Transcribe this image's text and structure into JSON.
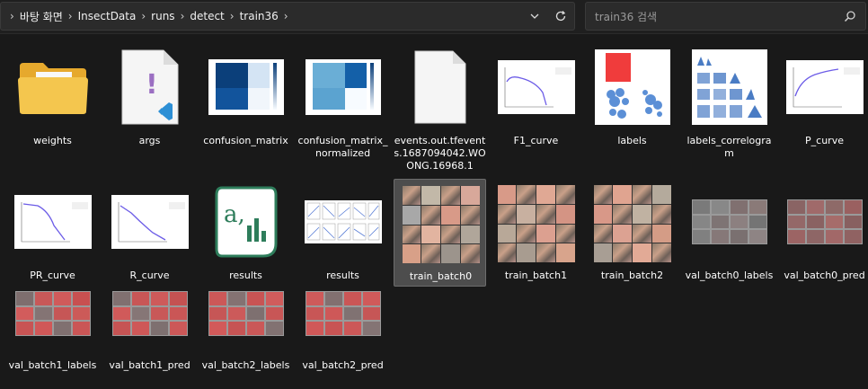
{
  "breadcrumb": {
    "items": [
      "바탕 화면",
      "InsectData",
      "runs",
      "detect",
      "train36"
    ]
  },
  "search": {
    "placeholder": "train36 검색"
  },
  "files": [
    {
      "name": "weights",
      "type": "folder"
    },
    {
      "name": "args",
      "type": "yaml"
    },
    {
      "name": "confusion_matrix",
      "type": "image"
    },
    {
      "name": "confusion_matrix_normalized",
      "type": "image"
    },
    {
      "name": "events.out.tfevents.1687094042.WOONG.16968.1",
      "type": "file"
    },
    {
      "name": "F1_curve",
      "type": "image"
    },
    {
      "name": "labels",
      "type": "image"
    },
    {
      "name": "labels_correlogram",
      "type": "image"
    },
    {
      "name": "P_curve",
      "type": "image"
    },
    {
      "name": "PR_curve",
      "type": "image"
    },
    {
      "name": "R_curve",
      "type": "image"
    },
    {
      "name": "results",
      "type": "csv"
    },
    {
      "name": "results",
      "type": "image"
    },
    {
      "name": "train_batch0",
      "type": "image",
      "selected": true
    },
    {
      "name": "train_batch1",
      "type": "image"
    },
    {
      "name": "train_batch2",
      "type": "image"
    },
    {
      "name": "val_batch0_labels",
      "type": "image"
    },
    {
      "name": "val_batch0_pred",
      "type": "image"
    },
    {
      "name": "val_batch1_labels",
      "type": "image"
    },
    {
      "name": "val_batch1_pred",
      "type": "image"
    },
    {
      "name": "val_batch2_labels",
      "type": "image"
    },
    {
      "name": "val_batch2_pred",
      "type": "image"
    }
  ],
  "colors": {
    "background": "#191919",
    "folder": "#f4c64e",
    "csv_icon": "#2e7d5b",
    "selection": "#4d4d4d"
  }
}
